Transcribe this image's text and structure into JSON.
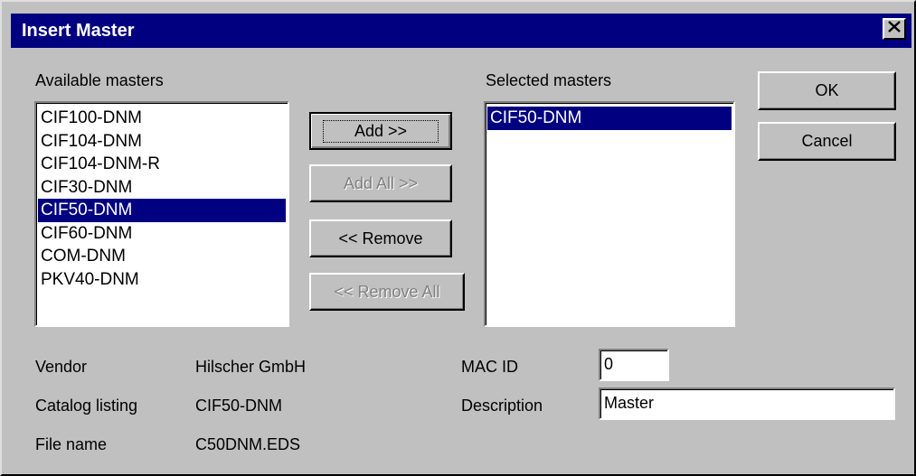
{
  "window": {
    "title": "Insert Master",
    "close_glyph": "✕"
  },
  "available": {
    "label": "Available masters",
    "items": [
      "CIF100-DNM",
      "CIF104-DNM",
      "CIF104-DNM-R",
      "CIF30-DNM",
      "CIF50-DNM",
      "CIF60-DNM",
      "COM-DNM",
      "PKV40-DNM"
    ],
    "selected": "CIF50-DNM"
  },
  "selected_masters": {
    "label": "Selected masters",
    "items": [
      "CIF50-DNM"
    ],
    "selected": "CIF50-DNM"
  },
  "buttons": {
    "add": "Add >>",
    "add_all": "Add All >>",
    "remove": "<< Remove",
    "remove_all": "<< Remove All",
    "ok": "OK",
    "cancel": "Cancel"
  },
  "info": {
    "vendor_label": "Vendor",
    "vendor_value": "Hilscher GmbH",
    "catalog_label": "Catalog listing",
    "catalog_value": "CIF50-DNM",
    "file_label": "File name",
    "file_value": "C50DNM.EDS"
  },
  "fields": {
    "mac_id_label": "MAC ID",
    "mac_id_value": "0",
    "description_label": "Description",
    "description_value": "Master"
  }
}
